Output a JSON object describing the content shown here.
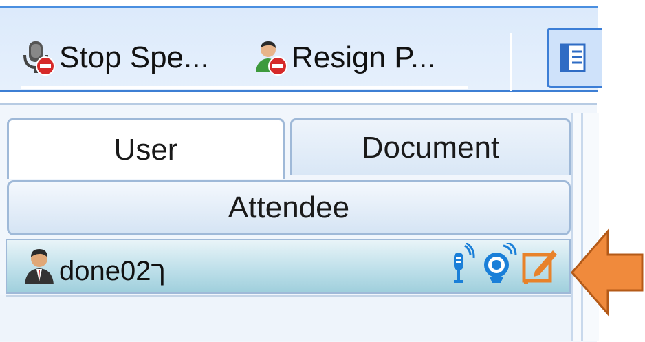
{
  "toolbar": {
    "stop_speaking_label": "Stop Spe...",
    "resign_label": "Resign P..."
  },
  "tabs": {
    "user": "User",
    "document": "Document"
  },
  "list": {
    "header": "Attendee",
    "attendees": [
      {
        "name": "done02ך",
        "icons": [
          "microphone-icon",
          "webcam-icon",
          "edit-icon"
        ]
      }
    ]
  },
  "colors": {
    "toolbar_border": "#3e7fd4",
    "mic_blue": "#1a7fd8",
    "edit_orange": "#e8822a",
    "annotation_arrow": "#f08a3c"
  }
}
